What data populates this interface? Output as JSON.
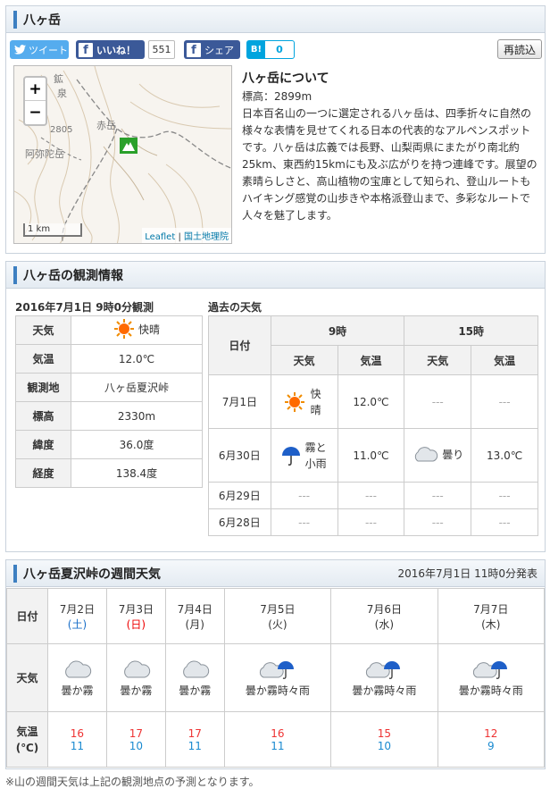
{
  "top": {
    "title": "八ヶ岳",
    "tweet_label": "ツイート",
    "like_label": "いいね！",
    "like_count": "551",
    "share_label": "シェア",
    "hatena_label": "B!",
    "hatena_count": "0",
    "reload_label": "再読込"
  },
  "map": {
    "zoom_in": "+",
    "zoom_out": "−",
    "scale": "1 km",
    "attrib_leaflet": "Leaflet",
    "attrib_sep": " | ",
    "attrib_gsi": "国土地理院",
    "labels": [
      "鉱",
      "泉",
      "2805",
      "赤岳",
      "阿弥陀岳"
    ]
  },
  "about": {
    "title": "八ヶ岳について",
    "elevation": "標高：2899m",
    "text": "日本百名山の一つに選定される八ヶ岳は、四季折々に自然の様々な表情を見せてくれる日本の代表的なアルペンスポットです。八ヶ岳は広義では長野、山梨両県にまたがり南北約25km、東西約15kmにも及ぶ広がりを持つ連峰です。展望の素晴らしさと、高山植物の宝庫として知られ、登山ルートもハイキング感覚の山歩きや本格派登山まで、多彩なルートで人々を魅了します。"
  },
  "observation": {
    "title": "八ヶ岳の観測情報",
    "time": "2016年7月1日 9時0分観測",
    "rows": [
      {
        "key": "天気",
        "value": "快晴",
        "icon": "sun-icon"
      },
      {
        "key": "気温",
        "value": "12.0℃"
      },
      {
        "key": "観測地",
        "value": "八ヶ岳夏沢峠"
      },
      {
        "key": "標高",
        "value": "2330m"
      },
      {
        "key": "緯度",
        "value": "36.0度"
      },
      {
        "key": "経度",
        "value": "138.4度"
      }
    ]
  },
  "past": {
    "title": "過去の天気",
    "col_date": "日付",
    "col_9": "9時",
    "col_15": "15時",
    "col_weather": "天気",
    "col_temp": "気温",
    "dash": "---",
    "rows": [
      {
        "date": "7月1日",
        "w9": "快晴",
        "t9": "12.0℃",
        "w15": "---",
        "t15": "---"
      },
      {
        "date": "6月30日",
        "w9": "霧と小雨",
        "t9": "11.0℃",
        "w15": "曇り",
        "t15": "13.0℃"
      },
      {
        "date": "6月29日",
        "w9": "---",
        "t9": "---",
        "w15": "---",
        "t15": "---"
      },
      {
        "date": "6月28日",
        "w9": "---",
        "t9": "---",
        "w15": "---",
        "t15": "---"
      }
    ]
  },
  "weekly": {
    "title": "八ヶ岳夏沢峠の週間天気",
    "published": "2016年7月1日 11時0分発表",
    "row_date": "日付",
    "row_weather": "天気",
    "row_temp": "気温",
    "row_temp_unit": "(℃)",
    "days": [
      {
        "date": "7月2日",
        "dow": "土",
        "weather": "曇か霧",
        "icon": "cloud-icon",
        "hi": "16",
        "lo": "11"
      },
      {
        "date": "7月3日",
        "dow": "日",
        "weather": "曇か霧",
        "icon": "cloud-icon",
        "hi": "17",
        "lo": "10"
      },
      {
        "date": "7月4日",
        "dow": "月",
        "weather": "曇か霧",
        "icon": "cloud-icon",
        "hi": "17",
        "lo": "11"
      },
      {
        "date": "7月5日",
        "dow": "火",
        "weather": "曇か霧時々雨",
        "icon": "cloud-umbrella-icon",
        "hi": "16",
        "lo": "11"
      },
      {
        "date": "7月6日",
        "dow": "水",
        "weather": "曇か霧時々雨",
        "icon": "cloud-umbrella-icon",
        "hi": "15",
        "lo": "10"
      },
      {
        "date": "7月7日",
        "dow": "木",
        "weather": "曇か霧時々雨",
        "icon": "cloud-umbrella-icon",
        "hi": "12",
        "lo": "9"
      }
    ],
    "note": "※山の週間天気は上記の観測地点の予測となります。"
  },
  "colors": {
    "accent": "#3d7fc1",
    "twitter": "#55acee",
    "facebook": "#3b5998",
    "hatena": "#00a4de",
    "high_temp": "#e33333",
    "low_temp": "#1a8ad0"
  }
}
